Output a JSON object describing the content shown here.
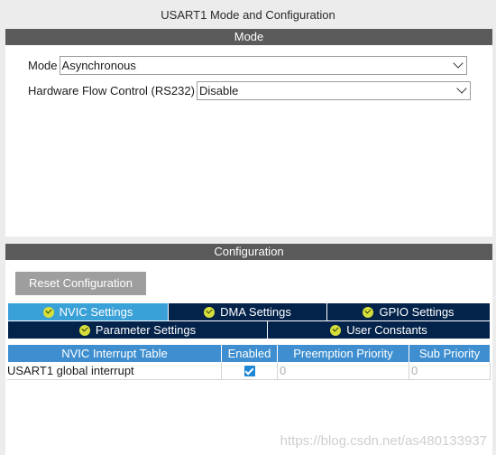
{
  "window": {
    "title": "USART1 Mode and Configuration"
  },
  "mode_section": {
    "header": "Mode",
    "mode": {
      "label": "Mode",
      "value": "Asynchronous"
    },
    "flow_control": {
      "label": "Hardware Flow Control (RS232)",
      "value": "Disable"
    }
  },
  "config_section": {
    "header": "Configuration",
    "reset_button": "Reset Configuration",
    "tabs": [
      {
        "label": "NVIC Settings",
        "active": true
      },
      {
        "label": "DMA Settings",
        "active": false
      },
      {
        "label": "GPIO Settings",
        "active": false
      },
      {
        "label": "Parameter Settings",
        "active": false
      },
      {
        "label": "User Constants",
        "active": false
      }
    ],
    "table": {
      "headers": [
        "NVIC Interrupt Table",
        "Enabled",
        "Preemption Priority",
        "Sub Priority"
      ],
      "rows": [
        {
          "name": "USART1 global interrupt",
          "enabled": true,
          "preemption": "0",
          "sub": "0"
        }
      ]
    }
  },
  "watermark": "https://blog.csdn.net/as480133937",
  "colors": {
    "section_header": "#5a5a5a",
    "tab_active": "#39a0d8",
    "tab_inactive": "#03234b",
    "table_header": "#3f8fd0",
    "check_badge": "#d6de3c"
  },
  "icons": {
    "tab_status": "check-circle-icon",
    "dropdown": "chevron-down-icon",
    "enabled": "checkbox-checked-icon"
  }
}
